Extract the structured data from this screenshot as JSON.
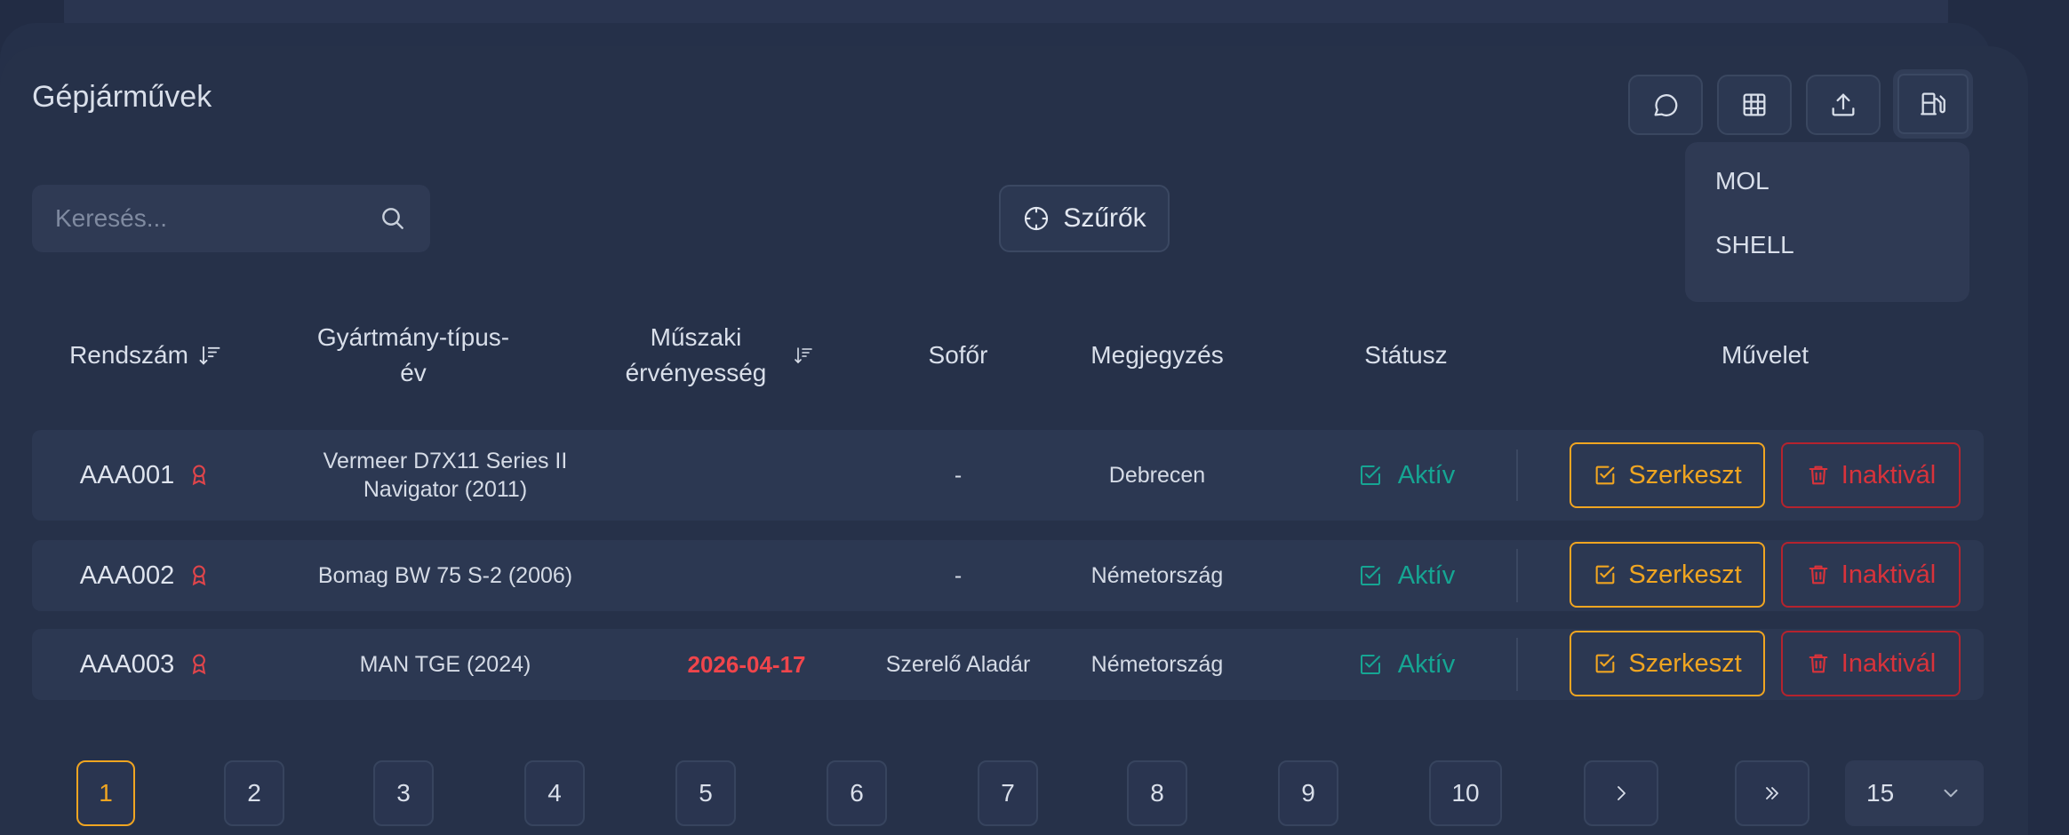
{
  "page": {
    "title": "Gépjárművek"
  },
  "toolbar": {
    "buttons": [
      {
        "name": "comment-icon"
      },
      {
        "name": "table-icon"
      },
      {
        "name": "upload-icon"
      },
      {
        "name": "fuel-station-icon"
      }
    ]
  },
  "fuel_menu": {
    "items": [
      "MOL",
      "SHELL"
    ]
  },
  "search": {
    "placeholder": "Keresés...",
    "value": ""
  },
  "filters": {
    "label": "Szűrők"
  },
  "table": {
    "headers": {
      "plate": "Rendszám",
      "make_model_line1": "Gyártmány-típus-",
      "make_model_line2": "év",
      "inspection_line1": "Műszaki",
      "inspection_line2": "érvényesség",
      "driver": "Sofőr",
      "note": "Megjegyzés",
      "status": "Státusz",
      "action": "Művelet"
    },
    "rows": [
      {
        "plate": "AAA001",
        "model_line1": "Vermeer D7X11 Series II",
        "model_line2": "Navigator (2011)",
        "inspection": "",
        "driver": "-",
        "note": "Debrecen",
        "status": "Aktív"
      },
      {
        "plate": "AAA002",
        "model_line1": "Bomag BW 75 S-2 (2006)",
        "model_line2": "",
        "inspection": "",
        "driver": "-",
        "note": "Németország",
        "status": "Aktív"
      },
      {
        "plate": "AAA003",
        "model_line1": "MAN TGE (2024)",
        "model_line2": "",
        "inspection": "2026-04-17",
        "driver": "Szerelő Aladár",
        "note": "Németország",
        "status": "Aktív"
      }
    ],
    "edit_label": "Szerkeszt",
    "deactivate_label": "Inaktivál"
  },
  "pagination": {
    "pages": [
      "1",
      "2",
      "3",
      "4",
      "5",
      "6",
      "7",
      "8",
      "9",
      "10"
    ],
    "current": "1",
    "next": "›",
    "last": "»",
    "page_size": "15"
  },
  "colors": {
    "accent": "#f0a521",
    "danger": "#d8333b",
    "success": "#16a593",
    "background": "#222c44"
  }
}
